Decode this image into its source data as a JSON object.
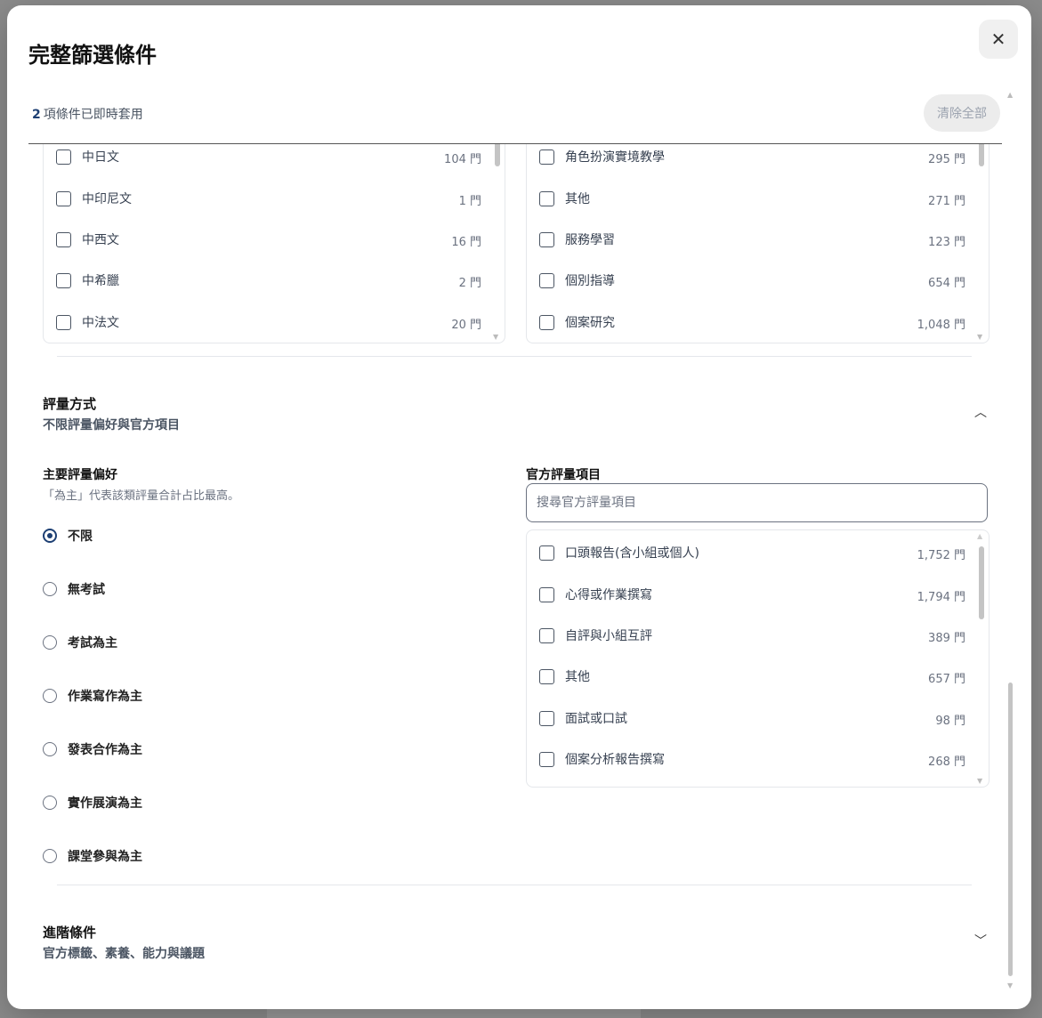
{
  "modal": {
    "title": "完整篩選條件",
    "close_icon": "close-icon",
    "summary_count": "2",
    "summary_text": "項條件已即時套用",
    "clear_all_label": "清除全部"
  },
  "left_list": {
    "items": [
      {
        "label": "中日文",
        "count": "104 門"
      },
      {
        "label": "中印尼文",
        "count": "1 門"
      },
      {
        "label": "中西文",
        "count": "16 門"
      },
      {
        "label": "中希臘",
        "count": "2 門"
      },
      {
        "label": "中法文",
        "count": "20 門"
      }
    ]
  },
  "right_list": {
    "items": [
      {
        "label": "角色扮演實境教學",
        "count": "295 門"
      },
      {
        "label": "其他",
        "count": "271 門"
      },
      {
        "label": "服務學習",
        "count": "123 門"
      },
      {
        "label": "個別指導",
        "count": "654 門"
      },
      {
        "label": "個案研究",
        "count": "1,048 門"
      }
    ]
  },
  "assessment": {
    "title": "評量方式",
    "subtitle": "不限評量偏好與官方項目",
    "chevron_icon": "chevron-up-icon",
    "preference_title": "主要評量偏好",
    "preference_note": "「為主」代表該類評量合計占比最高。",
    "options": [
      {
        "label": "不限",
        "selected": true
      },
      {
        "label": "無考試",
        "selected": false
      },
      {
        "label": "考試為主",
        "selected": false
      },
      {
        "label": "作業寫作為主",
        "selected": false
      },
      {
        "label": "發表合作為主",
        "selected": false
      },
      {
        "label": "實作展演為主",
        "selected": false
      },
      {
        "label": "課堂參與為主",
        "selected": false
      }
    ],
    "official_title": "官方評量項目",
    "search_placeholder": "搜尋官方評量項目",
    "official_items": [
      {
        "label": "口頭報告(含小組或個人)",
        "count": "1,752 門"
      },
      {
        "label": "心得或作業撰寫",
        "count": "1,794 門"
      },
      {
        "label": "自評與小組互評",
        "count": "389 門"
      },
      {
        "label": "其他",
        "count": "657 門"
      },
      {
        "label": "面試或口試",
        "count": "98 門"
      },
      {
        "label": "個案分析報告撰寫",
        "count": "268 門"
      }
    ]
  },
  "advanced": {
    "title": "進階條件",
    "subtitle": "官方標籤、素養、能力與議題",
    "chevron_icon": "chevron-down-icon"
  },
  "colors": {
    "accent": "#1d3f73",
    "overlay": "#7a7a7a"
  }
}
